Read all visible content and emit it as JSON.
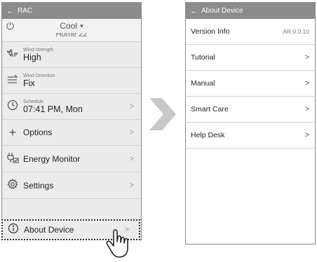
{
  "left": {
    "title": "RAC",
    "mode": "Cool",
    "mode_caret": "▾",
    "home_partial": "Home 22",
    "wind_strength": {
      "label": "Wind strength",
      "value": "High"
    },
    "wind_direction": {
      "label": "Wind Direction",
      "value": "Fix"
    },
    "schedule": {
      "label": "Schedule",
      "value": "07:41 PM, Mon"
    },
    "options": "Options",
    "energy_monitor": "Energy Monitor",
    "settings": "Settings",
    "about_device": "About Device",
    "chevron": ">"
  },
  "right": {
    "title": "About Device",
    "items": [
      {
        "label": "Version Info",
        "value": "AR.0.0.10",
        "chevron": ""
      },
      {
        "label": "Tutorial",
        "value": "",
        "chevron": ">"
      },
      {
        "label": "Manual",
        "value": "",
        "chevron": ">"
      },
      {
        "label": "Smart Care",
        "value": "",
        "chevron": ">"
      },
      {
        "label": "Help Desk",
        "value": "",
        "chevron": ">"
      }
    ]
  },
  "icons": {
    "back": "←",
    "power": "⏻",
    "plus": "+",
    "info": "ⓘ"
  },
  "colors": {
    "topbar": "#8c8c8c",
    "arrow": "#c8c8c8"
  }
}
